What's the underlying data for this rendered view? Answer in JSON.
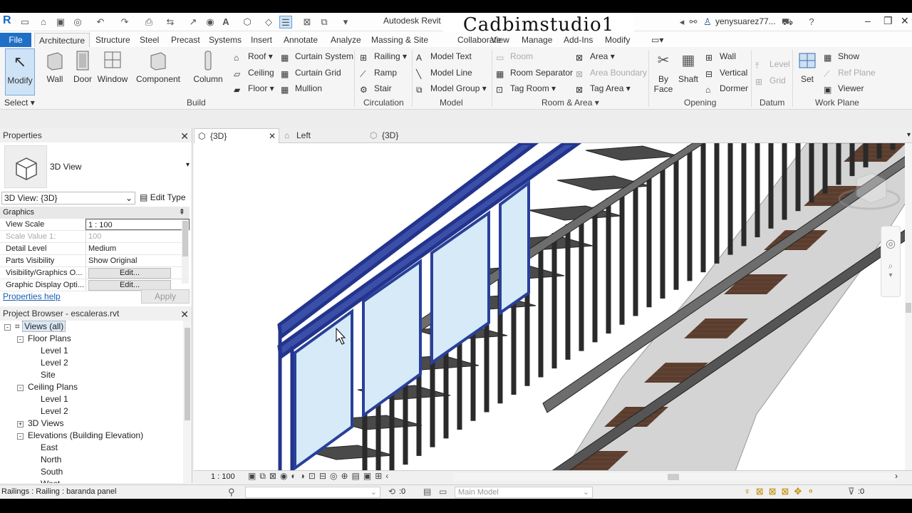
{
  "window": {
    "title": "Autodesk Revit 2",
    "user": "yenysuarez77...",
    "watermark": "Cadbimstudio1"
  },
  "menu_tabs": [
    "File",
    "Architecture",
    "Structure",
    "Steel",
    "Precast",
    "Systems",
    "Insert",
    "Annotate",
    "Analyze",
    "Massing & Site",
    "Collaborate",
    "View",
    "Manage",
    "Add-Ins",
    "Modify"
  ],
  "ribbon": {
    "select_label": "Select",
    "modify": "Modify",
    "build": {
      "wall": "Wall",
      "door": "Door",
      "window": "Window",
      "component": "Component",
      "column": "Column",
      "roof": "Roof",
      "ceiling": "Ceiling",
      "floor": "Floor",
      "curtain_system": "Curtain System",
      "curtain_grid": "Curtain Grid",
      "mullion": "Mullion",
      "group": "Build"
    },
    "circulation": {
      "railing": "Railing",
      "ramp": "Ramp",
      "stair": "Stair",
      "group": "Circulation"
    },
    "model": {
      "model_text": "Model Text",
      "model_line": "Model Line",
      "model_group": "Model Group",
      "group": "Model"
    },
    "room_area": {
      "room": "Room",
      "room_separator": "Room Separator",
      "tag_room": "Tag Room",
      "area": "Area",
      "area_boundary": "Area Boundary",
      "tag_area": "Tag Area",
      "group": "Room & Area"
    },
    "opening": {
      "by_face_1": "By",
      "by_face_2": "Face",
      "shaft": "Shaft",
      "wall": "Wall",
      "vertical": "Vertical",
      "dormer": "Dormer",
      "group": "Opening"
    },
    "datum": {
      "level": "Level",
      "grid": "Grid",
      "group": "Datum"
    },
    "work_plane": {
      "set": "Set",
      "show": "Show",
      "ref_plane": "Ref Plane",
      "viewer": "Viewer",
      "group": "Work Plane"
    }
  },
  "properties": {
    "header": "Properties",
    "type_name": "3D View",
    "selector": "3D View: {3D}",
    "edit_type": "Edit Type",
    "category": "Graphics",
    "rows": [
      {
        "k": "View Scale",
        "v": "1 : 100"
      },
      {
        "k": "Scale Value    1:",
        "v": "100"
      },
      {
        "k": "Detail Level",
        "v": "Medium"
      },
      {
        "k": "Parts Visibility",
        "v": "Show Original"
      },
      {
        "k": "Visibility/Graphics O...",
        "v": "Edit..."
      },
      {
        "k": "Graphic Display Opti...",
        "v": "Edit..."
      }
    ],
    "help": "Properties help",
    "apply": "Apply"
  },
  "browser": {
    "header": "Project Browser - escaleras.rvt",
    "nodes": [
      {
        "label": "Views (all)",
        "level": 0,
        "toggle": "-"
      },
      {
        "label": "Floor Plans",
        "level": 1,
        "toggle": "-"
      },
      {
        "label": "Level 1",
        "level": 2,
        "toggle": ""
      },
      {
        "label": "Level 2",
        "level": 2,
        "toggle": ""
      },
      {
        "label": "Site",
        "level": 2,
        "toggle": ""
      },
      {
        "label": "Ceiling Plans",
        "level": 1,
        "toggle": "-"
      },
      {
        "label": "Level 1",
        "level": 2,
        "toggle": ""
      },
      {
        "label": "Level 2",
        "level": 2,
        "toggle": ""
      },
      {
        "label": "3D Views",
        "level": 1,
        "toggle": "+"
      },
      {
        "label": "Elevations (Building Elevation)",
        "level": 1,
        "toggle": "-"
      },
      {
        "label": "East",
        "level": 2,
        "toggle": ""
      },
      {
        "label": "North",
        "level": 2,
        "toggle": ""
      },
      {
        "label": "South",
        "level": 2,
        "toggle": ""
      },
      {
        "label": "West",
        "level": 2,
        "toggle": ""
      }
    ]
  },
  "view_tabs": [
    "{3D}",
    "Left",
    "{3D}"
  ],
  "view_control": {
    "scale": "1 : 100"
  },
  "status": {
    "text": "Railings : Railing : baranda panel",
    "selection_count": ":0",
    "model": "Main Model",
    "filter_count": ":0"
  }
}
